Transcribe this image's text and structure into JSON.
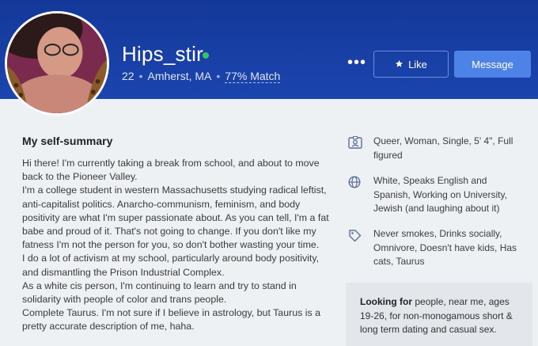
{
  "profile": {
    "username": "Hips_stir",
    "online": true,
    "age": "22",
    "location": "Amherst, MA",
    "match": "77% Match",
    "more_label": "•••",
    "like_label": "Like",
    "message_label": "Message"
  },
  "summary": {
    "title": "My self-summary",
    "paragraphs": [
      "Hi there! I'm currently taking a break from school, and about to move back to the Pioneer Valley.",
      "I'm a college student in western Massachusetts studying radical leftist, anti-capitalist politics. Anarcho-communism, feminism, and body positivity are what I'm super passionate about. As you can tell, I'm a fat babe and proud of it. That's not going to change. If you don't like my fatness I'm not the person for you, so don't bother wasting your time.",
      "I do a lot of activism at my school, particularly around body positivity, and dismantling the Prison Industrial Complex.",
      "As a white cis person, I'm continuing to learn and try to stand in solidarity with people of color and trans people.",
      "Complete Taurus. I'm not sure if I believe in astrology, but Taurus is a pretty accurate description of me, haha."
    ]
  },
  "details": {
    "basics": "Queer, Woman, Single, 5' 4\", Full figured",
    "background": "White, Speaks English and Spanish, Working on University, Jewish (and laughing about it)",
    "lifestyle": "Never smokes, Drinks socially, Omnivore, Doesn't have kids, Has cats, Taurus"
  },
  "looking_for": {
    "label": "Looking for",
    "text": "people, near me, ages 19-26, for non-monogamous short & long term dating and casual sex."
  },
  "colors": {
    "header": "#1b45ad",
    "accent_button": "#4d82e6",
    "online": "#35c36a"
  }
}
